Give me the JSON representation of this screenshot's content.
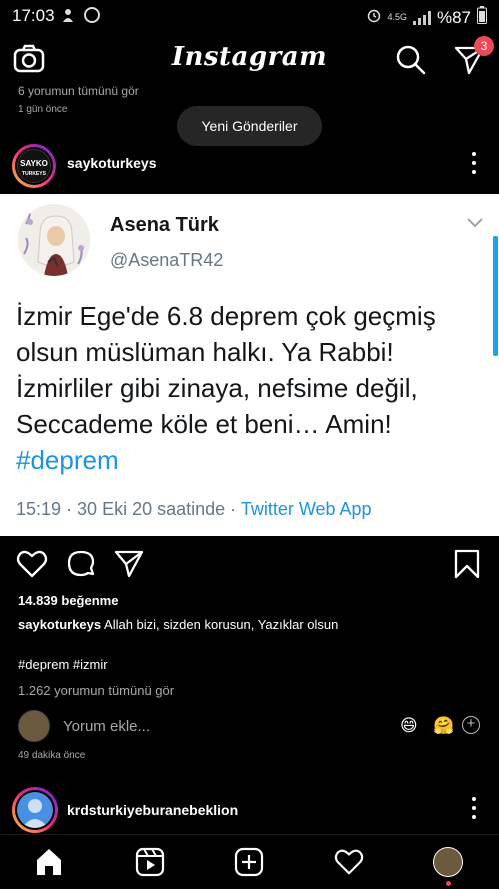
{
  "status_bar": {
    "time": "17:03",
    "network": "4.5G",
    "battery": "%87"
  },
  "header": {
    "app_title": "Instagram",
    "messages_badge": "3"
  },
  "previous_post": {
    "comment_preview": "6 yorumun tümünü gör",
    "time": "1 gün önce"
  },
  "new_posts_pill": "Yeni Gönderiler",
  "post": {
    "username": "saykoturkeys",
    "avatar_text": "SAYKO TURKEYS",
    "tweet": {
      "name": "Asena Türk",
      "handle": "@AsenaTR42",
      "text": "İzmir Ege'de 6.8  deprem çok geçmiş olsun müslüman halkı. Ya Rabbi! İzmirliler gibi zinaya, nefsime değil, Seccademe köle et beni… Amin! ",
      "hashtag": "#deprem",
      "meta": "15:19 · 30 Eki 20 saatinde · ",
      "app": "Twitter Web App"
    },
    "likes": "14.839 beğenme",
    "caption_user": "saykoturkeys",
    "caption_text": " Allah bizi,  sizden korusun, Yazıklar olsun",
    "hashtags": "#deprem #izmir",
    "view_comments": "1.262 yorumun tümünü gör",
    "comment_placeholder": "Yorum ekle...",
    "emoji_1": "😄",
    "emoji_2": "🤗",
    "time": "49 dakika önce"
  },
  "next_post": {
    "username": "krdsturkiyeburanebeklion"
  },
  "icons": {
    "camera": "camera-icon",
    "search": "search-icon",
    "direct": "paper-plane-icon",
    "like": "heart-icon",
    "comment": "comment-icon",
    "share": "share-icon",
    "save": "bookmark-icon",
    "home": "home-icon",
    "reels": "reels-icon",
    "new_post": "plus-square-icon",
    "activity": "heart-icon"
  },
  "colors": {
    "background": "#000000",
    "badge": "#ed4956",
    "link_blue": "#1b95e0",
    "muted": "#a8a8a8"
  }
}
